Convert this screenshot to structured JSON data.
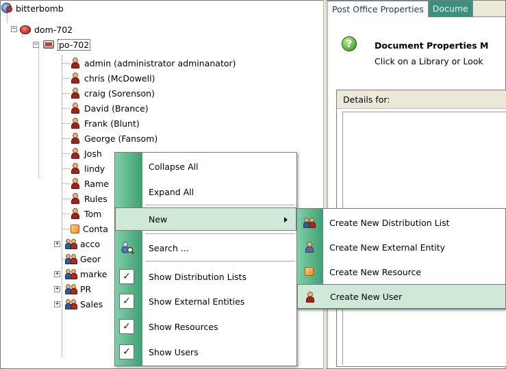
{
  "tree": {
    "root": {
      "label": "bitterbomb"
    },
    "domain": {
      "label": "dom-702"
    },
    "post_office": {
      "label": "po-702"
    },
    "users": [
      {
        "label": "admin (administrator  adminanator)"
      },
      {
        "label": "chris (McDowell)"
      },
      {
        "label": "craig (Sorenson)"
      },
      {
        "label": "David (Brance)"
      },
      {
        "label": "Frank (Blunt)"
      },
      {
        "label": "George (Fansom)"
      },
      {
        "label": "Josh"
      },
      {
        "label": "lindy"
      },
      {
        "label": "Rame"
      },
      {
        "label": "Rules"
      },
      {
        "label": "Tom"
      }
    ],
    "resource": {
      "label": "Conta"
    },
    "groups": [
      {
        "label": "acco",
        "expandable": true
      },
      {
        "label": "Geor",
        "expandable": false
      },
      {
        "label": "marke",
        "expandable": true
      },
      {
        "label": "PR",
        "expandable": true
      },
      {
        "label": "Sales",
        "expandable": true
      }
    ]
  },
  "right_pane": {
    "tabs": [
      "Post Office Properties",
      "Docume"
    ],
    "title": "Document Properties M",
    "subtitle": "Click on a Library or Look",
    "details_label": "Details for:"
  },
  "context_menu": {
    "collapse_all": "Collapse All",
    "expand_all": "Expand All",
    "new": "New",
    "search": "Search ...",
    "show_distribution_lists": "Show Distribution Lists",
    "show_external_entities": "Show External Entities",
    "show_resources": "Show Resources",
    "show_users": "Show Users",
    "check_mark": "✓"
  },
  "submenu": {
    "create_distribution_list": "Create New Distribution List",
    "create_external_entity": "Create New External Entity",
    "create_resource": "Create New Resource",
    "create_user": "Create New User"
  },
  "colors": {
    "menu_strip": "#3f9f72",
    "menu_highlight": "#cfe8d8",
    "tab_inactive": "#3f8f7f"
  }
}
